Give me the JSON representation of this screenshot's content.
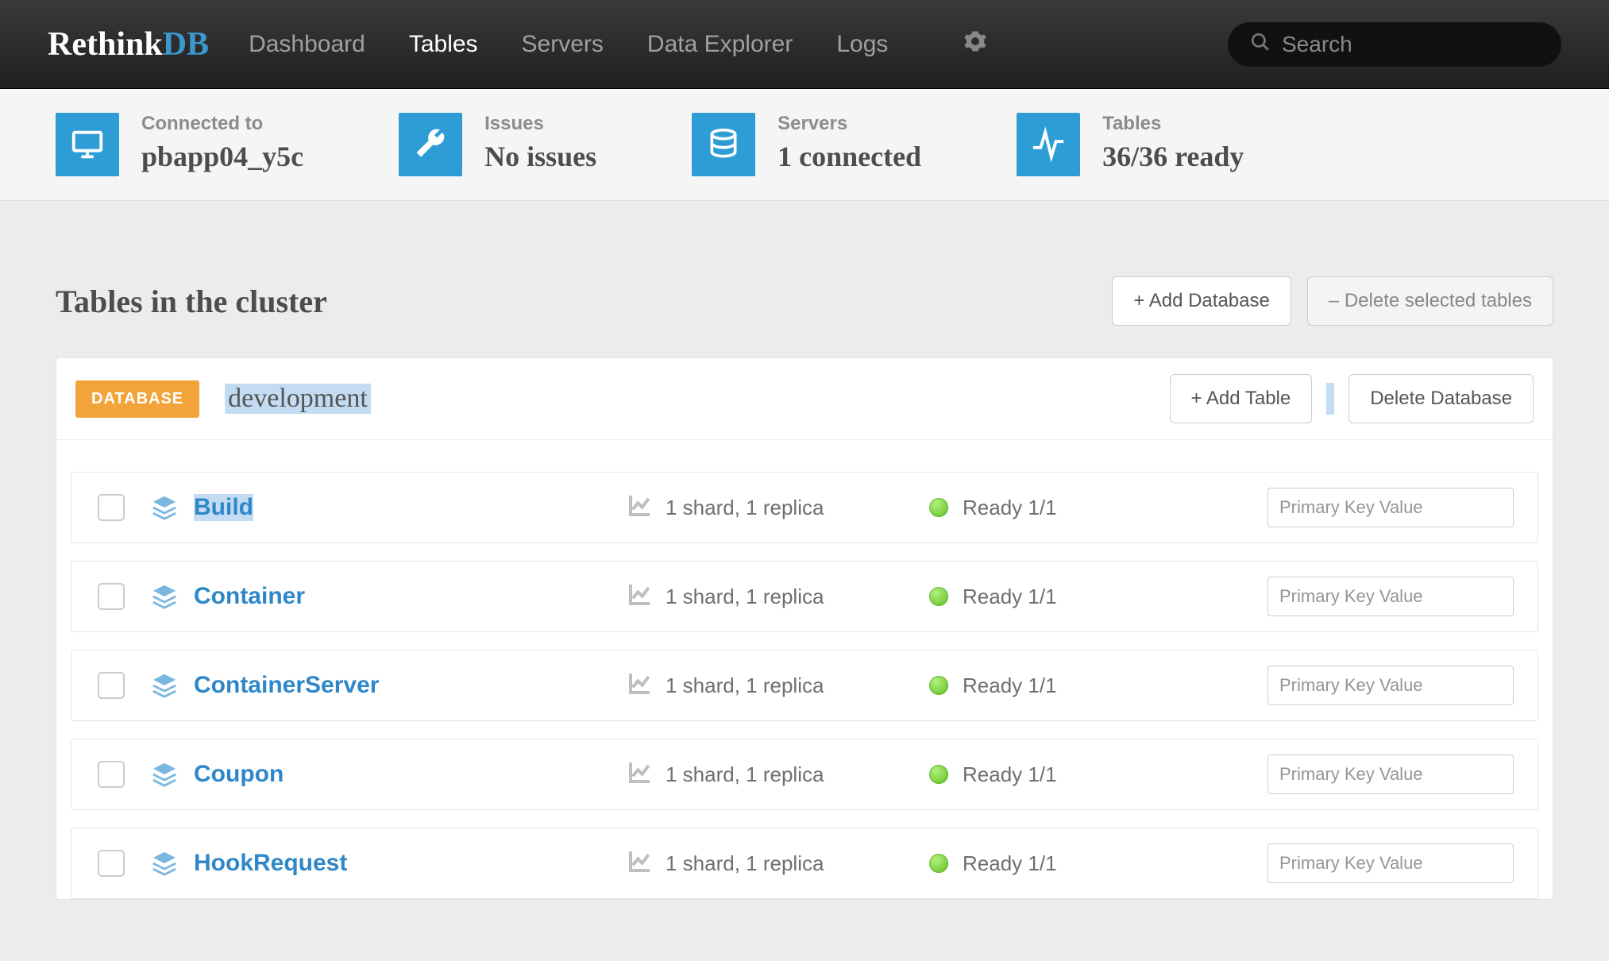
{
  "brand": {
    "a": "Rethink",
    "b": "DB"
  },
  "nav": {
    "items": [
      {
        "label": "Dashboard",
        "active": false
      },
      {
        "label": "Tables",
        "active": true
      },
      {
        "label": "Servers",
        "active": false
      },
      {
        "label": "Data Explorer",
        "active": false
      },
      {
        "label": "Logs",
        "active": false
      }
    ],
    "search_placeholder": "Search"
  },
  "status": {
    "connected": {
      "label": "Connected to",
      "value": "pbapp04_y5c"
    },
    "issues": {
      "label": "Issues",
      "value": "No issues"
    },
    "servers": {
      "label": "Servers",
      "value": "1 connected"
    },
    "tables": {
      "label": "Tables",
      "value": "36/36 ready"
    }
  },
  "page": {
    "title": "Tables in the cluster",
    "add_db": "+ Add Database",
    "delete_sel": "– Delete selected tables"
  },
  "database": {
    "badge": "DATABASE",
    "name": "development",
    "add_table": "+ Add Table",
    "delete_db": "Delete Database",
    "pk_placeholder": "Primary Key Value",
    "tables": [
      {
        "name": "Build",
        "shard": "1 shard, 1 replica",
        "status": "Ready 1/1",
        "selected": true
      },
      {
        "name": "Container",
        "shard": "1 shard, 1 replica",
        "status": "Ready 1/1",
        "selected": false
      },
      {
        "name": "ContainerServer",
        "shard": "1 shard, 1 replica",
        "status": "Ready 1/1",
        "selected": false
      },
      {
        "name": "Coupon",
        "shard": "1 shard, 1 replica",
        "status": "Ready 1/1",
        "selected": false
      },
      {
        "name": "HookRequest",
        "shard": "1 shard, 1 replica",
        "status": "Ready 1/1",
        "selected": false
      }
    ]
  }
}
